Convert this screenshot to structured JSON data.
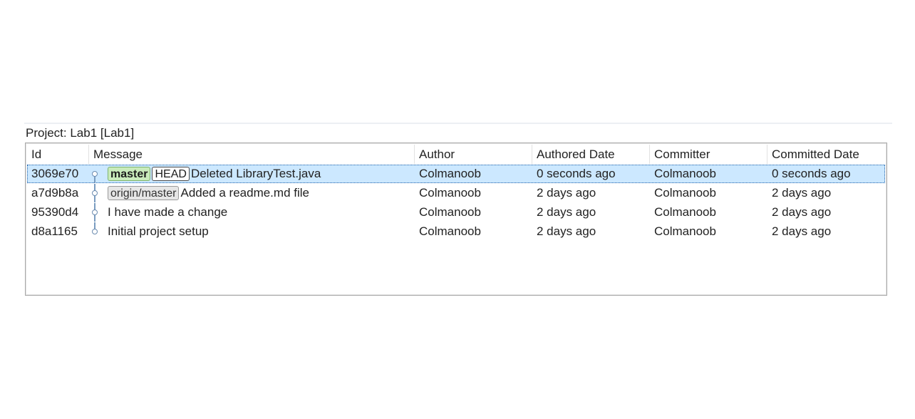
{
  "project": {
    "label": "Project: Lab1 [Lab1]"
  },
  "columns": {
    "id": "Id",
    "message": "Message",
    "author": "Author",
    "authored_date": "Authored Date",
    "committer": "Committer",
    "committed_date": "Committed Date"
  },
  "commits": [
    {
      "id": "3069e70",
      "refs": [
        {
          "label": "master",
          "kind": "local-branch"
        },
        {
          "label": "HEAD",
          "kind": "head"
        }
      ],
      "message": "Deleted LibraryTest.java",
      "author": "Colmanoob",
      "authored_date": "0 seconds ago",
      "committer": "Colmanoob",
      "committed_date": "0 seconds ago",
      "selected": true
    },
    {
      "id": "a7d9b8a",
      "refs": [
        {
          "label": "origin/master",
          "kind": "remote-branch"
        }
      ],
      "message": "Added a readme.md file",
      "author": "Colmanoob",
      "authored_date": "2 days ago",
      "committer": "Colmanoob",
      "committed_date": "2 days ago",
      "selected": false
    },
    {
      "id": "95390d4",
      "refs": [],
      "message": "I have made a change",
      "author": "Colmanoob",
      "authored_date": "2 days ago",
      "committer": "Colmanoob",
      "committed_date": "2 days ago",
      "selected": false
    },
    {
      "id": "d8a1165",
      "refs": [],
      "message": "Initial project setup",
      "author": "Colmanoob",
      "authored_date": "2 days ago",
      "committer": "Colmanoob",
      "committed_date": "2 days ago",
      "selected": false
    }
  ],
  "colors": {
    "selection": "#cce8ff",
    "local_branch_bg": "#c9ebbc",
    "remote_branch_bg": "#e6e6e6",
    "graph_line": "#7a9cc0"
  },
  "icons": {
    "commit_node": "commit-node-icon"
  }
}
